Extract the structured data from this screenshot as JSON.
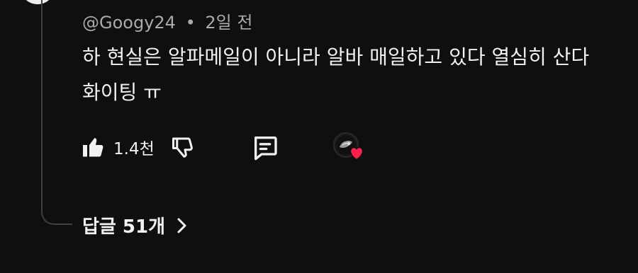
{
  "comment": {
    "author": "@Googy24",
    "separator": "•",
    "time": "2일 전",
    "text": "하 현실은 알파메일이 아니라 알바 매일하고 있다 열심히 산다 화이팅 ㅠ"
  },
  "actions": {
    "like_count": "1.4천",
    "icons": [
      "thumbs-up-icon",
      "thumbs-down-icon",
      "reply-icon",
      "heart-icon"
    ]
  },
  "replies": {
    "label": "답글 51개",
    "chevron_icon": "chevron-right-icon"
  },
  "colors": {
    "background": "#0f0f0f",
    "text": "#f1f1f1",
    "meta": "#aaaaaa",
    "thread_line": "#3f3f3f",
    "heart": "#ff1f4b"
  }
}
